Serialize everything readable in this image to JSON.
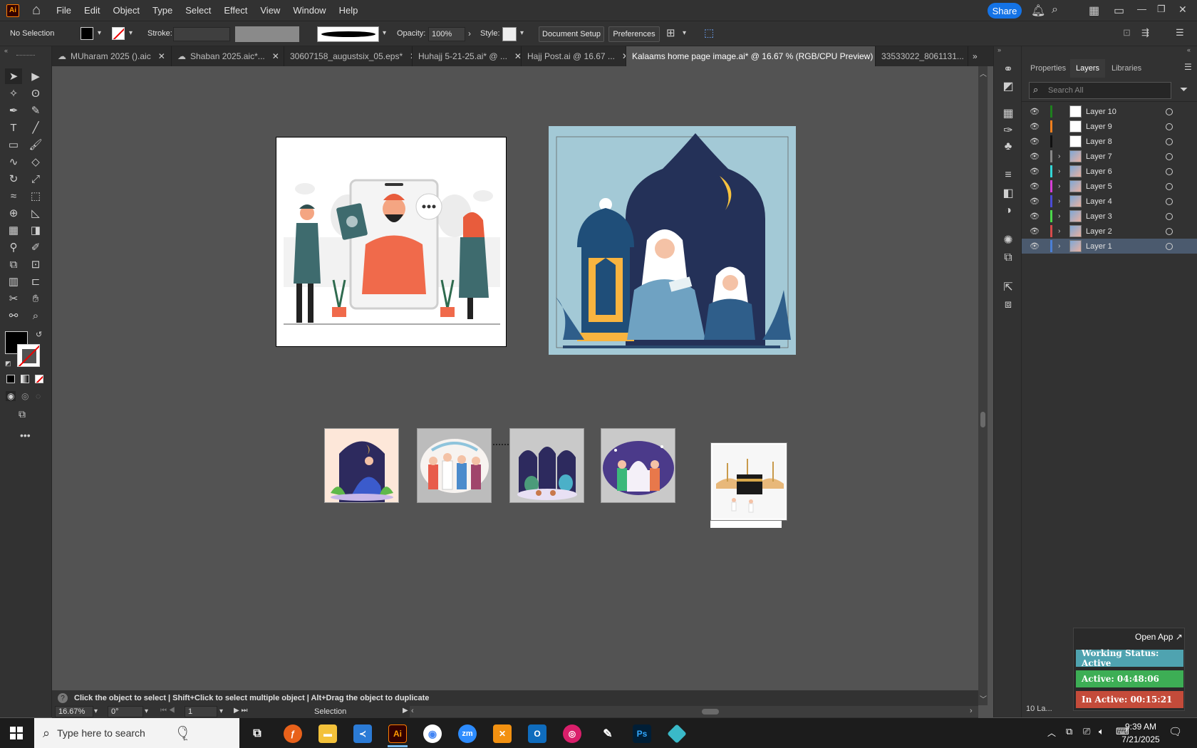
{
  "menubar": {
    "app_logo": "Ai",
    "items": [
      "File",
      "Edit",
      "Object",
      "Type",
      "Select",
      "Effect",
      "View",
      "Window",
      "Help"
    ],
    "share_label": "Share"
  },
  "control": {
    "selection_label": "No Selection",
    "stroke_label": "Stroke:",
    "opacity_label": "Opacity:",
    "opacity_value": "100%",
    "style_label": "Style:",
    "document_setup": "Document Setup",
    "preferences": "Preferences"
  },
  "tabs": [
    {
      "label": "MUharam 2025 ().aic"
    },
    {
      "label": "Shaban 2025.aic*..."
    },
    {
      "label": "30607158_augustsix_05.eps*"
    },
    {
      "label": "Huhajj 5-21-25.ai* @ ..."
    },
    {
      "label": "Hajj Post.ai @ 16.67 ..."
    },
    {
      "label": "Kalaams home page image.ai* @ 16.67 % (RGB/CPU Preview)"
    },
    {
      "label": "33533022_8061131..."
    }
  ],
  "panel": {
    "tabs": [
      "Properties",
      "Layers",
      "Libraries"
    ],
    "search_placeholder": "Search All",
    "layers": [
      {
        "name": "Layer 10",
        "color": "#1e7f1e",
        "expandable": false,
        "thumb": "white"
      },
      {
        "name": "Layer 9",
        "color": "#f07f1e",
        "expandable": false,
        "thumb": "white"
      },
      {
        "name": "Layer 8",
        "color": "#111111",
        "expandable": false,
        "thumb": "white"
      },
      {
        "name": "Layer 7",
        "color": "#888888",
        "expandable": true,
        "thumb": "art"
      },
      {
        "name": "Layer 6",
        "color": "#33d6d6",
        "expandable": true,
        "thumb": "art"
      },
      {
        "name": "Layer 5",
        "color": "#d63fd6",
        "expandable": true,
        "thumb": "art"
      },
      {
        "name": "Layer 4",
        "color": "#4b4bd6",
        "expandable": true,
        "thumb": "art"
      },
      {
        "name": "Layer 3",
        "color": "#4bd64b",
        "expandable": true,
        "thumb": "art"
      },
      {
        "name": "Layer 2",
        "color": "#d64b4b",
        "expandable": true,
        "thumb": "art"
      },
      {
        "name": "Layer 1",
        "color": "#4b7fd6",
        "expandable": true,
        "thumb": "art",
        "selected": true
      }
    ],
    "layers_count": "10 La..."
  },
  "statusbar": {
    "hint": "Click the object to select  |  Shift+Click to select multiple object  |  Alt+Drag the object to duplicate",
    "zoom": "16.67%",
    "rotation": "0°",
    "artboard": "1",
    "tool": "Selection"
  },
  "tracker": {
    "open_app": "Open App ↗",
    "working_status": "Working Status: Active",
    "active": "Active: 04:48:06",
    "inactive": "In Active: 00:15:21"
  },
  "taskbar": {
    "search_placeholder": "Type here to search",
    "time": "9:39 AM",
    "date": "7/21/2025"
  }
}
